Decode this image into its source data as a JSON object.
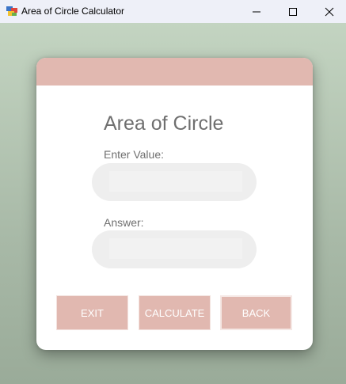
{
  "window": {
    "title": "Area of Circle Calculator",
    "controls": {
      "minimize": "minimize",
      "maximize": "maximize",
      "close": "close"
    }
  },
  "form": {
    "heading": "Area of Circle",
    "value_label": "Enter Value:",
    "value_input": "",
    "answer_label": "Answer:",
    "answer_input": ""
  },
  "buttons": {
    "exit": "EXIT",
    "calculate": "CALCULATE",
    "back": "BACK"
  },
  "colors": {
    "accent": "#e1b8b0",
    "background_top": "#c3d4c1",
    "background_bottom": "#9aab99",
    "input_fill": "#eeeeee"
  }
}
